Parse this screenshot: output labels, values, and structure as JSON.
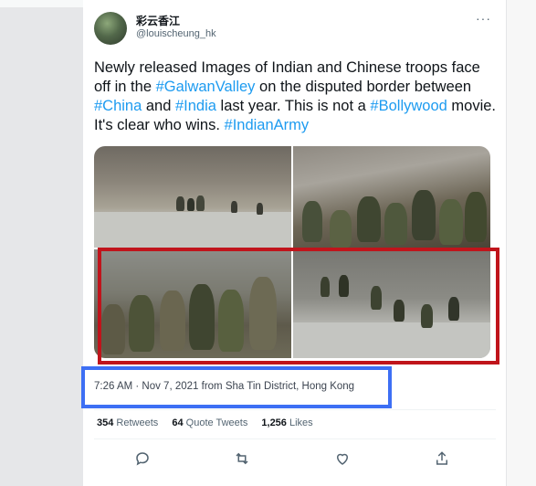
{
  "tweet": {
    "display_name": "彩云香江",
    "handle": "@louischeung_hk",
    "more_icon": "more-dots-icon",
    "text_segments": [
      {
        "text": "Newly released Images of Indian and Chinese troops face off in the ",
        "type": "plain"
      },
      {
        "text": "#GalwanValley",
        "type": "hashtag"
      },
      {
        "text": " on the disputed border between ",
        "type": "plain"
      },
      {
        "text": "#China",
        "type": "hashtag"
      },
      {
        "text": " and ",
        "type": "plain"
      },
      {
        "text": "#India",
        "type": "hashtag"
      },
      {
        "text": " last year. This is not a ",
        "type": "plain"
      },
      {
        "text": "#Bollywood",
        "type": "hashtag"
      },
      {
        "text": " movie. It's clear who wins. ",
        "type": "plain"
      },
      {
        "text": "#IndianArmy",
        "type": "hashtag"
      }
    ],
    "timestamp": "7:26 AM · Nov 7, 2021 from Sha Tin District, Hong Kong",
    "stats": {
      "retweets_count": "354",
      "retweets_label": "Retweets",
      "quotes_count": "64",
      "quotes_label": "Quote Tweets",
      "likes_count": "1,256",
      "likes_label": "Likes"
    },
    "actions": [
      "reply-icon",
      "retweet-icon",
      "like-icon",
      "share-icon"
    ]
  },
  "annotations": {
    "red_box_color": "#c0141b",
    "blue_box_color": "#3d6ff4"
  },
  "colors": {
    "hashtag": "#1d9bf0",
    "secondary_text": "#536471",
    "primary_text": "#0f1419"
  }
}
